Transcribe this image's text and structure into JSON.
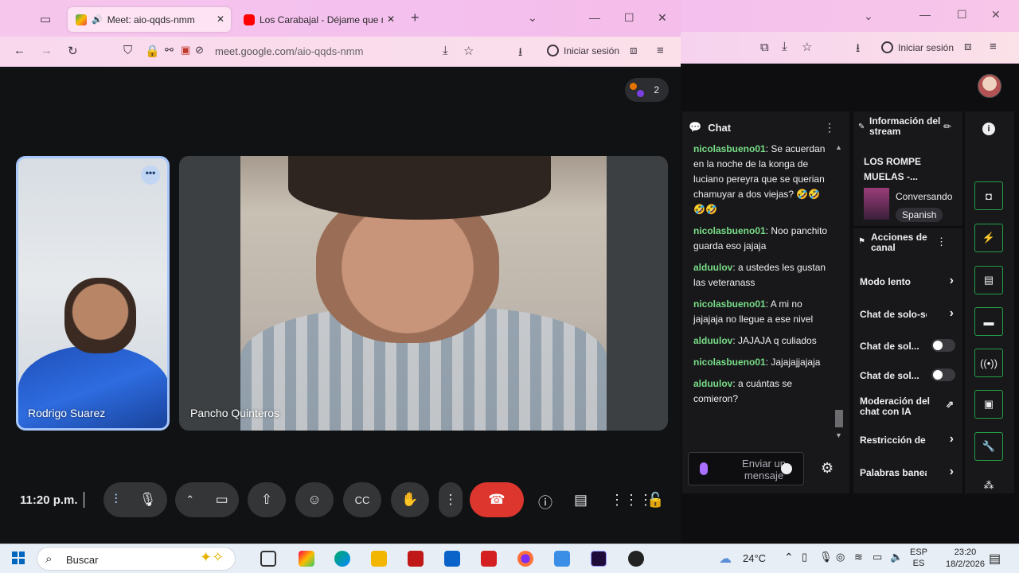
{
  "front_window": {
    "tabs": [
      {
        "label": "Meet: aio-qqds-nmm",
        "active": true
      },
      {
        "label": "Los Carabajal - Déjame que me",
        "active": false
      }
    ],
    "new_tab": "+",
    "url_host": "meet.google.com",
    "url_path": "/aio-qqds-nmm",
    "signin_label": "Iniciar sesión"
  },
  "meet": {
    "participant_count": "2",
    "tiles": [
      {
        "name": "Rodrigo Suarez",
        "more": "•••"
      },
      {
        "name": "Pancho Quinteros"
      }
    ],
    "time": "11:20 p.m."
  },
  "back_window": {
    "signin_label": "Iniciar sesión"
  },
  "chat": {
    "title": "Chat",
    "messages": [
      {
        "user": "nicolasbueno01",
        "text": ": Se acuerdan en la noche de la konga de luciano pereyra que se querian chamuyar a dos viejas? 🤣🤣🤣🤣"
      },
      {
        "user": "nicolasbueno01",
        "text": ": Noo panchito guarda eso jajaja"
      },
      {
        "user": "alduulov",
        "text": ": a ustedes les gustan las veteranass"
      },
      {
        "user": "nicolasbueno01",
        "text": ": A mi no jajajaja no llegue a ese nivel"
      },
      {
        "user": "alduulov",
        "text": ": JAJAJA q culiados"
      },
      {
        "user": "nicolasbueno01",
        "text": ": Jajajajjajaja"
      },
      {
        "user": "alduulov",
        "text": ": a cuántas se comieron?"
      }
    ],
    "send_placeholder": "Enviar un mensaje"
  },
  "stream_info": {
    "title": "Información del stream",
    "stream_title": "LOS ROMPE MUELAS -...",
    "category": "Conversando",
    "language": "Spanish"
  },
  "channel_actions": {
    "title": "Acciones de canal",
    "items": [
      {
        "label": "Modo lento",
        "control": "chevron"
      },
      {
        "label": "Chat de solo-se",
        "control": "chevron"
      },
      {
        "label": "Chat de sol...",
        "control": "toggle"
      },
      {
        "label": "Chat de sol...",
        "control": "toggle"
      },
      {
        "label": "Moderación del chat con IA",
        "control": "external"
      },
      {
        "label": "Restricción de c",
        "control": "chevron"
      },
      {
        "label": "Palabras banea",
        "control": "chevron"
      }
    ]
  },
  "taskbar": {
    "search_placeholder": "Buscar",
    "weather": "24°C",
    "lang_top": "ESP",
    "lang_bottom": "ES",
    "time": "23:20",
    "date": "18/2/2026"
  },
  "colors": {
    "chat_username": "#78dd86",
    "end_call": "#dc362e",
    "tile_highlight": "#a8c7fa",
    "rail_border": "#24a148"
  }
}
